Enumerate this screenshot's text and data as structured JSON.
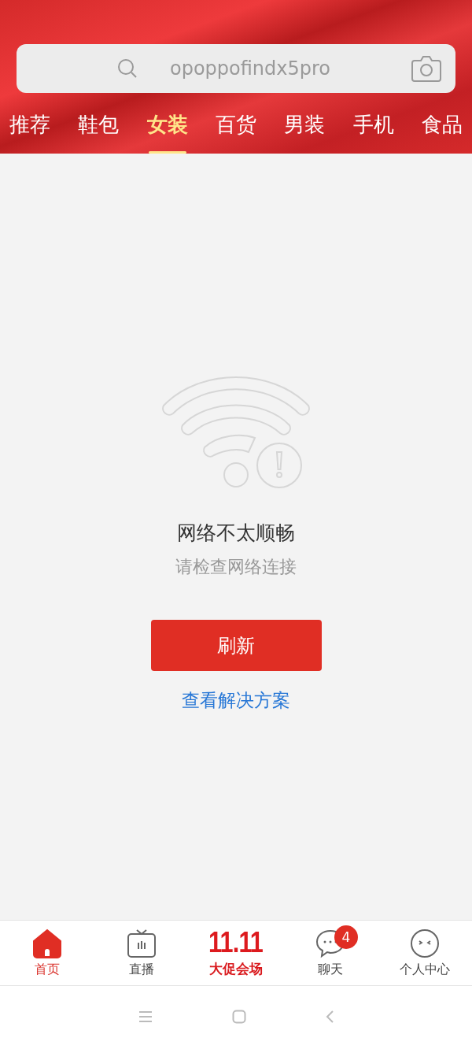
{
  "search": {
    "placeholder": "opoppofindx5pro"
  },
  "tabs": [
    {
      "label": "推荐",
      "selected": false
    },
    {
      "label": "鞋包",
      "selected": false
    },
    {
      "label": "女装",
      "selected": true
    },
    {
      "label": "百货",
      "selected": false
    },
    {
      "label": "男装",
      "selected": false
    },
    {
      "label": "手机",
      "selected": false
    },
    {
      "label": "食品",
      "selected": false
    }
  ],
  "error": {
    "title": "网络不太顺畅",
    "message": "请检查网络连接",
    "button": "刷新",
    "link": "查看解决方案"
  },
  "bottom_nav": [
    {
      "kind": "home",
      "label": "首页",
      "selected": true
    },
    {
      "kind": "live",
      "label": "直播",
      "selected": false
    },
    {
      "kind": "promo",
      "logo": "11.11",
      "label": "大促会场",
      "selected": false
    },
    {
      "kind": "chat",
      "label": "聊天",
      "badge": "4",
      "selected": false
    },
    {
      "kind": "profile",
      "label": "个人中心",
      "selected": false
    }
  ]
}
